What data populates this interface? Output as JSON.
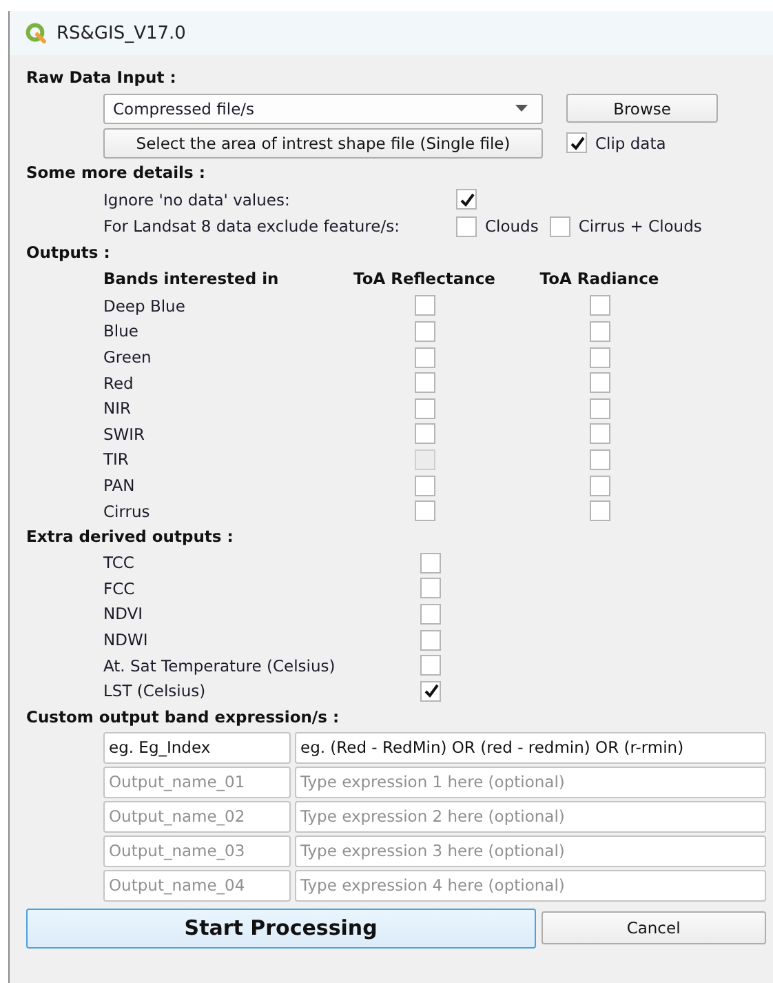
{
  "window": {
    "title": "RS&GIS_V17.0"
  },
  "raw_data_input": {
    "heading": "Raw Data Input :",
    "source": {
      "value": "Compressed file/s"
    },
    "browse_button": "Browse",
    "shape_button": "Select the area of intrest shape file (Single file)",
    "clip": {
      "label": "Clip data",
      "checked": true
    }
  },
  "more_details": {
    "heading": "Some more details :",
    "ignore_no_data": {
      "label": "Ignore 'no data' values:",
      "checked": true
    },
    "exclude": {
      "label": "For Landsat 8 data exclude feature/s:",
      "options": [
        {
          "label": "Clouds",
          "checked": false
        },
        {
          "label": "Cirrus + Clouds",
          "checked": false
        }
      ]
    }
  },
  "outputs": {
    "heading": "Outputs :",
    "columns": [
      "Bands interested in",
      "ToA Reflectance",
      "ToA Radiance"
    ],
    "rows": [
      {
        "band": "Deep Blue",
        "reflectance": {
          "checked": false,
          "disabled": false
        },
        "radiance": {
          "checked": false,
          "disabled": false
        }
      },
      {
        "band": "Blue",
        "reflectance": {
          "checked": false,
          "disabled": false
        },
        "radiance": {
          "checked": false,
          "disabled": false
        }
      },
      {
        "band": "Green",
        "reflectance": {
          "checked": false,
          "disabled": false
        },
        "radiance": {
          "checked": false,
          "disabled": false
        }
      },
      {
        "band": "Red",
        "reflectance": {
          "checked": false,
          "disabled": false
        },
        "radiance": {
          "checked": false,
          "disabled": false
        }
      },
      {
        "band": "NIR",
        "reflectance": {
          "checked": false,
          "disabled": false
        },
        "radiance": {
          "checked": false,
          "disabled": false
        }
      },
      {
        "band": "SWIR",
        "reflectance": {
          "checked": false,
          "disabled": false
        },
        "radiance": {
          "checked": false,
          "disabled": false
        }
      },
      {
        "band": "TIR",
        "reflectance": {
          "checked": false,
          "disabled": true
        },
        "radiance": {
          "checked": false,
          "disabled": false
        }
      },
      {
        "band": "PAN",
        "reflectance": {
          "checked": false,
          "disabled": false
        },
        "radiance": {
          "checked": false,
          "disabled": false
        }
      },
      {
        "band": "Cirrus",
        "reflectance": {
          "checked": false,
          "disabled": false
        },
        "radiance": {
          "checked": false,
          "disabled": false
        }
      }
    ]
  },
  "extra_outputs": {
    "heading": "Extra derived outputs :",
    "items": [
      {
        "label": "TCC",
        "checked": false
      },
      {
        "label": "FCC",
        "checked": false
      },
      {
        "label": "NDVI",
        "checked": false
      },
      {
        "label": "NDWI",
        "checked": false
      },
      {
        "label": "At. Sat Temperature (Celsius)",
        "checked": false
      },
      {
        "label": "LST (Celsius)",
        "checked": true
      }
    ]
  },
  "custom_expressions": {
    "heading": "Custom output band expression/s :",
    "rows": [
      {
        "name": {
          "value": "eg. Eg_Index"
        },
        "expression": {
          "value": "eg. (Red - RedMin) OR (red - redmin) OR (r-rmin)"
        }
      },
      {
        "name": {
          "placeholder": "Output_name_01"
        },
        "expression": {
          "placeholder": "Type expression 1 here (optional)"
        }
      },
      {
        "name": {
          "placeholder": "Output_name_02"
        },
        "expression": {
          "placeholder": "Type expression 2 here (optional)"
        }
      },
      {
        "name": {
          "placeholder": "Output_name_03"
        },
        "expression": {
          "placeholder": "Type expression 3 here (optional)"
        }
      },
      {
        "name": {
          "placeholder": "Output_name_04"
        },
        "expression": {
          "placeholder": "Type expression 4 here (optional)"
        }
      }
    ]
  },
  "buttons": {
    "start": "Start Processing",
    "cancel": "Cancel"
  }
}
